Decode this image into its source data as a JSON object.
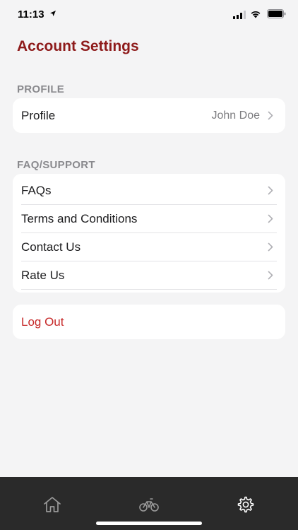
{
  "status_bar": {
    "time": "11:13"
  },
  "header": {
    "title": "Account Settings"
  },
  "profile_section": {
    "heading": "PROFILE",
    "row": {
      "label": "Profile",
      "value": "John Doe"
    }
  },
  "support_section": {
    "heading": "FAQ/SUPPORT",
    "items": [
      {
        "label": "FAQs"
      },
      {
        "label": "Terms and Conditions"
      },
      {
        "label": "Contact Us"
      },
      {
        "label": "Rate Us"
      }
    ]
  },
  "logout": {
    "label": "Log Out",
    "color": "#c62828"
  },
  "colors": {
    "accent": "#8e1b1b",
    "tab_bar": "#2a2a2a",
    "background": "#f4f4f5"
  },
  "tab_bar": {
    "tabs": [
      {
        "icon": "home-icon",
        "active": false
      },
      {
        "icon": "bicycle-icon",
        "active": false
      },
      {
        "icon": "gear-icon",
        "active": true
      }
    ]
  }
}
